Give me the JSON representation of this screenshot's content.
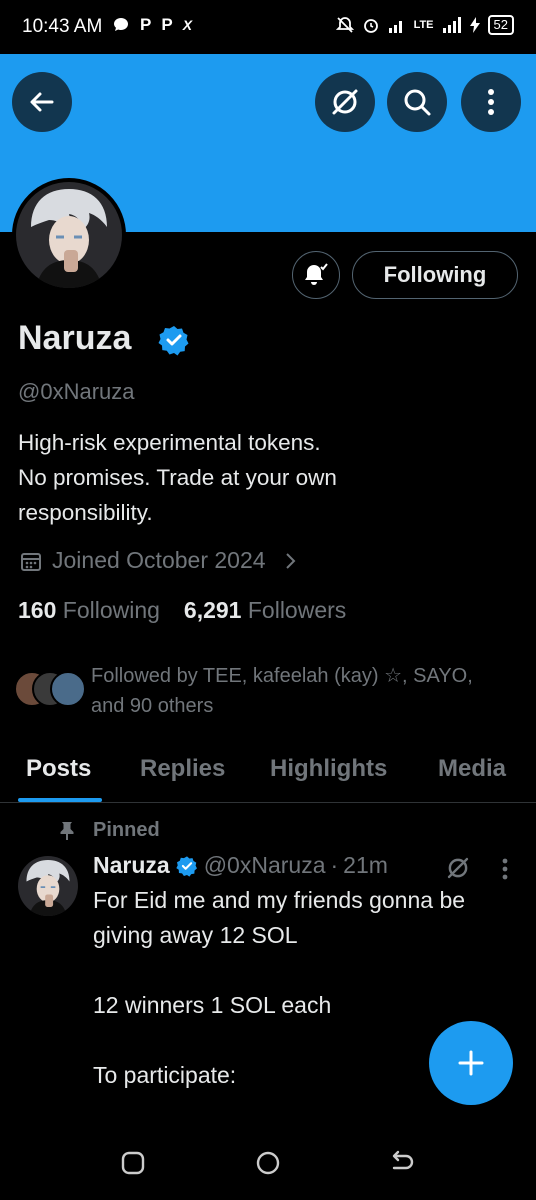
{
  "status_bar": {
    "time": "10:43 AM",
    "notif_icons": [
      "chat-bubble-icon",
      "P",
      "P",
      "X"
    ],
    "network": "LTE",
    "battery": "52"
  },
  "header": {
    "banner_color": "#1d9bf0",
    "back_icon": "arrow-left-icon",
    "grok_icon": "grok-icon",
    "search_icon": "search-icon",
    "more_icon": "more-vertical-icon"
  },
  "profile": {
    "display_name": "Naruza",
    "handle": "@0xNaruza",
    "bio_line1": "High-risk experimental tokens.",
    "bio_line2": "No promises. Trade at your own",
    "bio_line3": "responsibility.",
    "joined": "Joined October 2024",
    "following_count": "160",
    "following_label": "Following",
    "followers_count": "6,291",
    "followers_label": "Followers",
    "followed_by_line1": "Followed by TEE, kafeelah (kay) ☆, SAYO,",
    "followed_by_line2": "and 90 others",
    "follow_button_label": "Following",
    "verified_color": "#1d9bf0"
  },
  "tabs": [
    {
      "label": "Posts",
      "active": true
    },
    {
      "label": "Replies",
      "active": false
    },
    {
      "label": "Highlights",
      "active": false
    },
    {
      "label": "Media",
      "active": false
    }
  ],
  "post": {
    "pinned_label": "Pinned",
    "author_name": "Naruza",
    "author_handle": "@0xNaruza",
    "separator": "·",
    "time_ago": "21m",
    "text": "For Eid me and my friends gonna be giving away 12 SOL\n\n12 winners 1 SOL each\n\nTo participate:"
  },
  "fab": {
    "icon": "plus-icon",
    "color": "#1d9bf0"
  },
  "nav": {
    "recents_icon": "recents-icon",
    "home_icon": "home-icon",
    "back_icon": "back-nav-icon"
  }
}
